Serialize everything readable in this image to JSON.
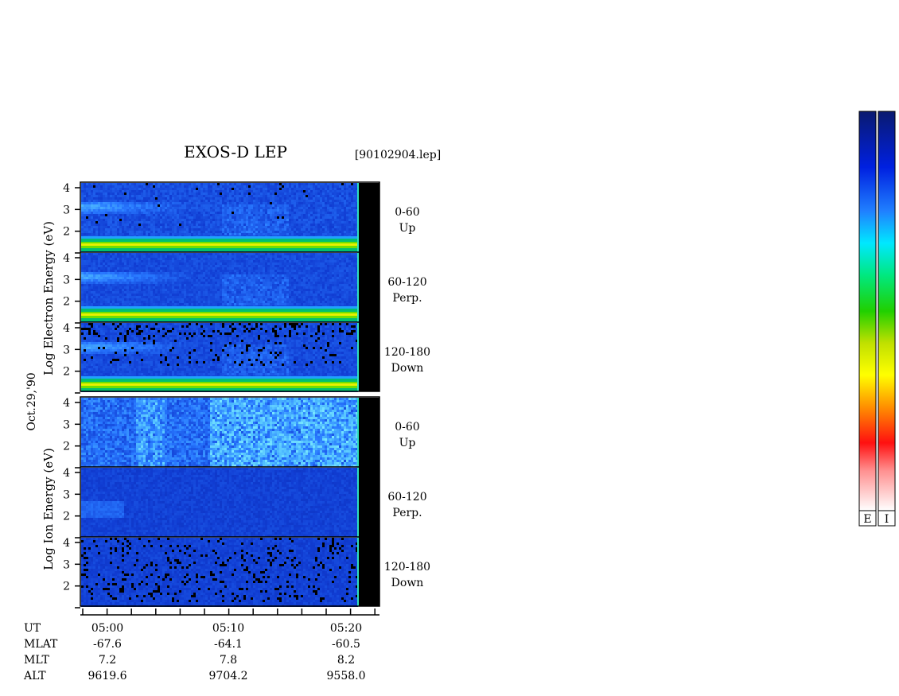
{
  "chart_data": {
    "type": "heatmap",
    "title": "EXOS-D LEP",
    "file_label": "[90102904.lep]",
    "date_label": "Oct.29,'90",
    "electron_panel": {
      "ylabel": "Log Electron Energy (eV)",
      "ylim": [
        1,
        4
      ],
      "yticks": [
        "4",
        "3",
        "2"
      ],
      "channels": [
        {
          "range": "0-60",
          "dir": "Up"
        },
        {
          "range": "60-120",
          "dir": "Perp."
        },
        {
          "range": "120-180",
          "dir": "Down"
        }
      ]
    },
    "ion_panel": {
      "ylabel": "Log Ion Energy (eV)",
      "ylim": [
        1,
        4
      ],
      "yticks": [
        "4",
        "3",
        "2"
      ],
      "channels": [
        {
          "range": "0-60",
          "dir": "Up"
        },
        {
          "range": "60-120",
          "dir": "Perp."
        },
        {
          "range": "120-180",
          "dir": "Down"
        }
      ]
    },
    "x_axis": {
      "row_labels": [
        "UT",
        "MLAT",
        "MLT",
        "ALT"
      ],
      "columns": [
        {
          "UT": "05:00",
          "MLAT": "-67.6",
          "MLT": "7.2",
          "ALT": "9619.6"
        },
        {
          "UT": "05:10",
          "MLAT": "-64.1",
          "MLT": "7.8",
          "ALT": "9704.2"
        },
        {
          "UT": "05:20",
          "MLAT": "-60.5",
          "MLT": "8.2",
          "ALT": "9558.0"
        }
      ]
    },
    "colorbars": [
      {
        "label": "E"
      },
      {
        "label": "I"
      }
    ],
    "colormap": [
      "#001a6e",
      "#0030d0",
      "#1870ff",
      "#30d0ff",
      "#00ffe0",
      "#00e060",
      "#40d000",
      "#c0e000",
      "#ffff00",
      "#ffa000",
      "#ff4000",
      "#ff0000",
      "#ffb0b0",
      "#ffffff"
    ]
  }
}
